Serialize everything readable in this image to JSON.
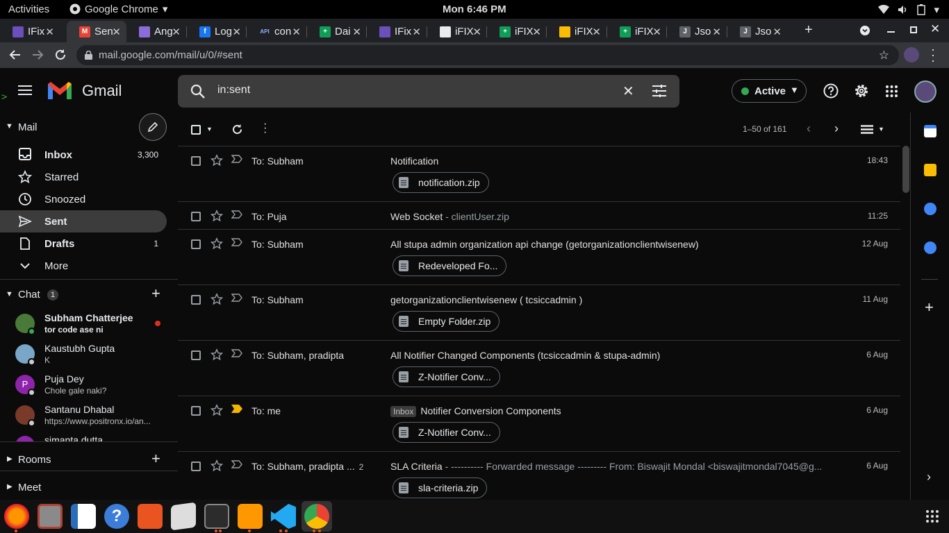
{
  "system_bar": {
    "activities": "Activities",
    "app_name": "Google Chrome",
    "clock": "Mon  6:46 PM"
  },
  "tabs": [
    {
      "label": "IFix",
      "fav_text": "",
      "fav_color": "#6b4fbb"
    },
    {
      "label": "Sen",
      "fav_text": "M",
      "fav_color": "#ea4335"
    },
    {
      "label": "Ang",
      "fav_text": "",
      "fav_color": "#8a6dd9"
    },
    {
      "label": "Log",
      "fav_text": "f",
      "fav_color": "#1877f2"
    },
    {
      "label": "con",
      "fav_text": "API",
      "fav_color": "#202124"
    },
    {
      "label": "Dai",
      "fav_text": "+",
      "fav_color": "#0f9d58"
    },
    {
      "label": "IFix",
      "fav_text": "",
      "fav_color": "#6b4fbb"
    },
    {
      "label": "iFIX",
      "fav_text": "",
      "fav_color": "#e8eaed"
    },
    {
      "label": "iFIX",
      "fav_text": "+",
      "fav_color": "#0f9d58"
    },
    {
      "label": "iFIX",
      "fav_text": "",
      "fav_color": "#fbbc04"
    },
    {
      "label": "iFIX",
      "fav_text": "+",
      "fav_color": "#0f9d58"
    },
    {
      "label": "Jso",
      "fav_text": "J",
      "fav_color": "#5f6368"
    },
    {
      "label": "Jso",
      "fav_text": "J",
      "fav_color": "#5f6368"
    }
  ],
  "omnibox": {
    "url": "mail.google.com/mail/u/0/#sent"
  },
  "gmail": {
    "logo_text": "Gmail",
    "search_query": "in:sent",
    "status": "Active",
    "mail_section": "Mail",
    "nav": [
      {
        "label": "Inbox",
        "count": "3,300",
        "icon": "inbox-icon",
        "bold": true
      },
      {
        "label": "Starred",
        "count": "",
        "icon": "star-icon",
        "bold": false
      },
      {
        "label": "Snoozed",
        "count": "",
        "icon": "clock-icon",
        "bold": false
      },
      {
        "label": "Sent",
        "count": "",
        "icon": "send-icon",
        "bold": true
      },
      {
        "label": "Drafts",
        "count": "1",
        "icon": "draft-icon",
        "bold": true
      },
      {
        "label": "More",
        "count": "",
        "icon": "chevron-down-icon",
        "bold": false
      }
    ],
    "chat": {
      "title": "Chat",
      "badge": "1",
      "people": [
        {
          "name": "Subham Chatterjee",
          "msg": "tor code ase ni",
          "bold": true,
          "avatar_color": "#4a7a3a"
        },
        {
          "name": "Kaustubh Gupta",
          "msg": "K",
          "bold": false,
          "avatar_color": "#7aa7c7"
        },
        {
          "name": "Puja Dey",
          "msg": "Chole gale naki?",
          "bold": false,
          "avatar_color": "#8e24aa",
          "initial": "P"
        },
        {
          "name": "Santanu Dhabal",
          "msg": "https://www.positronx.io/an...",
          "bold": false,
          "avatar_color": "#7a3a2a"
        },
        {
          "name": "simanta dutta",
          "msg": "",
          "bold": false,
          "avatar_color": "#8e24aa"
        }
      ]
    },
    "rooms": "Rooms",
    "meet": "Meet",
    "pagination": "1–50 of 161",
    "emails": [
      {
        "to": "To: Subham",
        "count": "",
        "subject": "Notification",
        "snippet": "",
        "date": "18:43",
        "attachment": "notification.zip",
        "label": "",
        "important": false
      },
      {
        "to": "To: Puja",
        "count": "",
        "subject": "Web Socket",
        "snippet": " - clientUser.zip",
        "date": "11:25",
        "attachment": "",
        "label": "",
        "important": false
      },
      {
        "to": "To: Subham",
        "count": "",
        "subject": "All stupa admin organization api change (getorganizationclientwisenew)",
        "snippet": "",
        "date": "12 Aug",
        "attachment": "Redeveloped Fo...",
        "label": "",
        "important": false
      },
      {
        "to": "To: Subham",
        "count": "",
        "subject": "getorganizationclientwisenew ( tcsiccadmin )",
        "snippet": "",
        "date": "11 Aug",
        "attachment": "Empty Folder.zip",
        "label": "",
        "important": false
      },
      {
        "to": "To: Subham, pradipta",
        "count": "",
        "subject": "All Notifier Changed Components (tcsiccadmin & stupa-admin)",
        "snippet": "",
        "date": "6 Aug",
        "attachment": "Z-Notifier Conv...",
        "label": "",
        "important": false
      },
      {
        "to": "To: me",
        "count": "",
        "subject": "Notifier Conversion Components",
        "snippet": "",
        "date": "6 Aug",
        "attachment": "Z-Notifier Conv...",
        "label": "Inbox",
        "important": true
      },
      {
        "to": "To: Subham, pradipta ...",
        "count": "2",
        "subject": "SLA Criteria",
        "snippet": " - ---------- Forwarded message --------- From: Biswajit Mondal <biswajitmondal7045@g...",
        "date": "6 Aug",
        "attachment": "sla-criteria.zip",
        "label": "",
        "important": false
      }
    ]
  },
  "colors": {
    "accent_red": "#ea4335",
    "active_green": "#34a853",
    "unread_dot": "#d93025",
    "important_yellow": "#f2b600"
  }
}
